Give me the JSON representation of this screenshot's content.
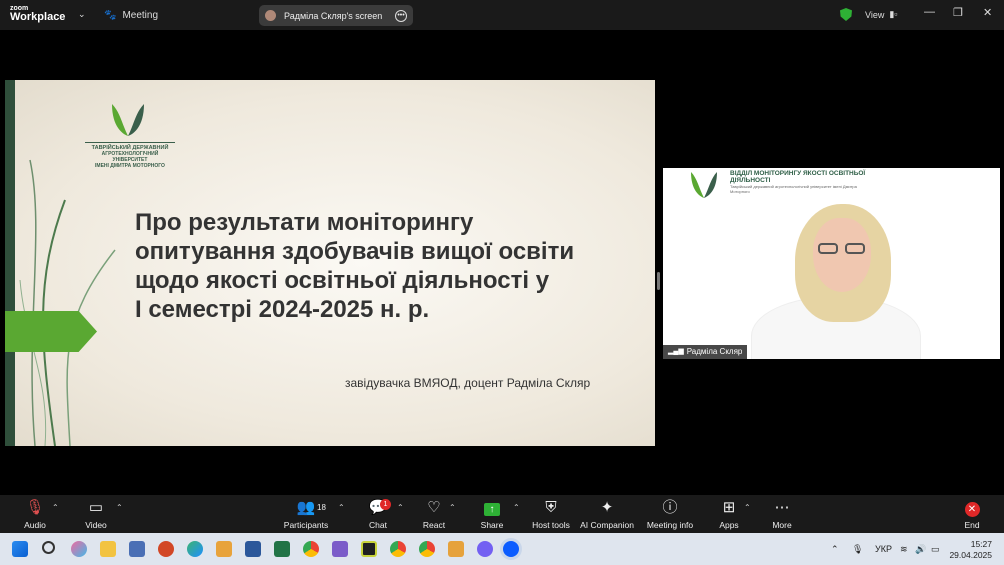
{
  "titlebar": {
    "brand_top": "zoom",
    "brand_bottom": "Workplace",
    "meeting_label": "Meeting",
    "share_label": "Радміла Скляр's screen",
    "view_label": "View"
  },
  "slide": {
    "university": [
      "ТАВРІЙСЬКИЙ ДЕРЖАВНИЙ",
      "АГРОТЕХНОЛОГІЧНИЙ УНІВЕРСИТЕТ",
      "ІМЕНІ ДМИТРА МОТОРНОГО"
    ],
    "title": [
      "Про результати моніторингу",
      "опитування здобувачів вищої освіти",
      "щодо якості освітньої діяльності у",
      "І семестрі 2024-2025 н. р."
    ],
    "subtitle": "завідувачка ВМЯОД, доцент Радміла Скляр"
  },
  "video": {
    "dept_title": [
      "ВІДДІЛ МОНІТОРИНГУ ЯКОСТІ ОСВІТНЬОЇ",
      "ДІЯЛЬНОСТІ"
    ],
    "dept_sub": "Таврійський державний агротехнологічний університет імені Дмитра Моторного",
    "name": "Радміла Скляр"
  },
  "toolbar": {
    "audio": "Audio",
    "video": "Video",
    "participants": "Participants",
    "participants_count": "18",
    "chat": "Chat",
    "chat_badge": "1",
    "react": "React",
    "share": "Share",
    "host_tools": "Host tools",
    "ai_companion": "AI Companion",
    "meeting_info": "Meeting info",
    "apps": "Apps",
    "more": "More",
    "end": "End"
  },
  "taskbar": {
    "lang": "УКР",
    "time": "15:27",
    "date": "29.04.2025"
  },
  "colors": {
    "accent_green": "#5aa832",
    "end_red": "#e02828",
    "share_green": "#2eb135"
  }
}
